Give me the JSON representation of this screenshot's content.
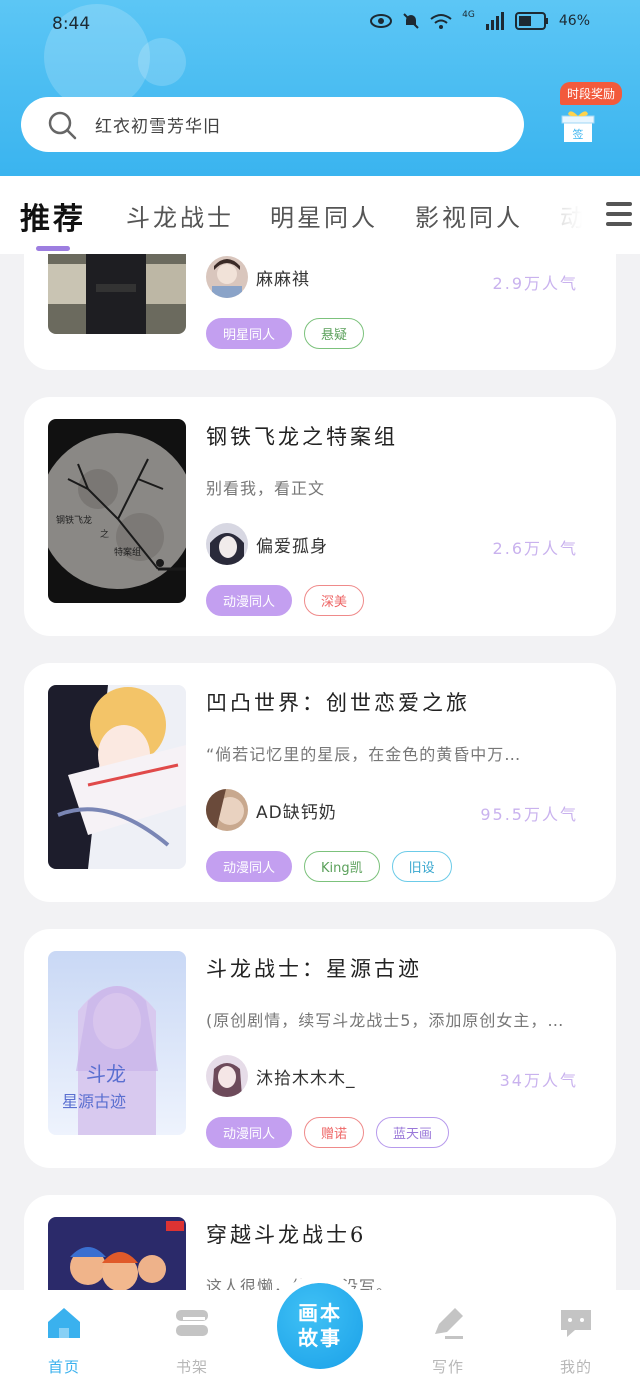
{
  "status_bar": {
    "time": "8:44",
    "network": "4G",
    "battery": "46%"
  },
  "search": {
    "placeholder": "红衣初雪芳华旧"
  },
  "reward": {
    "label": "时段奖励",
    "icon_text": "签"
  },
  "tabs": [
    {
      "label": "推荐",
      "active": true
    },
    {
      "label": "斗龙战士",
      "active": false
    },
    {
      "label": "明星同人",
      "active": false
    },
    {
      "label": "影视同人",
      "active": false
    },
    {
      "label": "动漫",
      "active": false
    }
  ],
  "cards": [
    {
      "title": "",
      "description": "",
      "author": "麻麻祺",
      "popularity": "2.9万人气",
      "tags": [
        {
          "label": "明星同人",
          "style": "purple"
        },
        {
          "label": "悬疑",
          "style": "green"
        }
      ]
    },
    {
      "title": "钢铁飞龙之特案组",
      "description": "别看我，看正文",
      "author": "偏爱孤身",
      "popularity": "2.6万人气",
      "cover_text": [
        "钢铁飞龙",
        "之",
        "特案组"
      ],
      "tags": [
        {
          "label": "动漫同人",
          "style": "purple"
        },
        {
          "label": "深美",
          "style": "red"
        }
      ]
    },
    {
      "title": "凹凸世界：创世恋爱之旅",
      "description": "“倘若记忆里的星辰，在金色的黄昏中万…",
      "author": "AD缺钙奶",
      "popularity": "95.5万人气",
      "tags": [
        {
          "label": "动漫同人",
          "style": "purple"
        },
        {
          "label": "King凯",
          "style": "green"
        },
        {
          "label": "旧设",
          "style": "cyan"
        }
      ]
    },
    {
      "title": "斗龙战士：星源古迹",
      "description": "(原创剧情，续写斗龙战士5，添加原创女主，…",
      "author": "沐拾木木木_",
      "popularity": "34万人气",
      "cover_text": [
        "斗龙",
        "星源古迹"
      ],
      "tags": [
        {
          "label": "动漫同人",
          "style": "purple"
        },
        {
          "label": "赠诺",
          "style": "red"
        },
        {
          "label": "蓝天画",
          "style": "violet"
        }
      ]
    },
    {
      "title": "穿越斗龙战士6",
      "description": "这人很懒，什么都没写。",
      "author": "",
      "popularity": "",
      "tags": []
    }
  ],
  "bottom_nav": {
    "items": [
      {
        "label": "首页",
        "icon": "home-icon",
        "active": true
      },
      {
        "label": "书架",
        "icon": "bookshelf-icon",
        "active": false
      },
      {
        "label": "写作",
        "icon": "pen-icon",
        "active": false
      },
      {
        "label": "我的",
        "icon": "chat-icon",
        "active": false
      }
    ],
    "center_button": {
      "line1": "画本",
      "line2": "故事"
    }
  },
  "colors": {
    "header": "#3ab4ef",
    "accent": "#9d7ee0",
    "popularity": "#c9b2ee",
    "nav_active": "#3ab1ee"
  }
}
